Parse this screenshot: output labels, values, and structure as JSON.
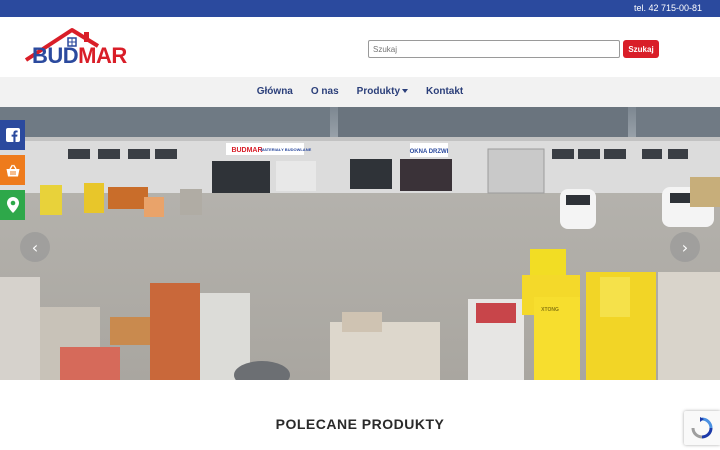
{
  "topbar": {
    "phone": "tel.  42 715-00-81"
  },
  "brand": {
    "logo_part1": "BUD",
    "logo_part2": "MAR"
  },
  "search": {
    "placeholder": "Szukaj",
    "button_label": "Szukaj"
  },
  "nav": {
    "items": [
      {
        "label": "Główna"
      },
      {
        "label": "O nas"
      },
      {
        "label": "Produkty"
      },
      {
        "label": "Kontakt"
      }
    ]
  },
  "hero": {
    "store_sign": "BUDMAR",
    "sign_materials": "MATERIAŁY BUDOWLANE",
    "sign_windows": "OKNA DRZWI",
    "pallet_brand": "XTONG"
  },
  "social": {
    "icons": [
      "facebook-icon",
      "shop-basket-icon",
      "location-pin-icon"
    ]
  },
  "section": {
    "title": "POLECANE PRODUKTY"
  },
  "colors": {
    "primary": "#2b4a9e",
    "accent": "#d91e28",
    "nav_text": "#2b3f7a",
    "facebook": "#2b4a9e",
    "shop": "#ee7b1c",
    "map": "#2ea84a"
  }
}
